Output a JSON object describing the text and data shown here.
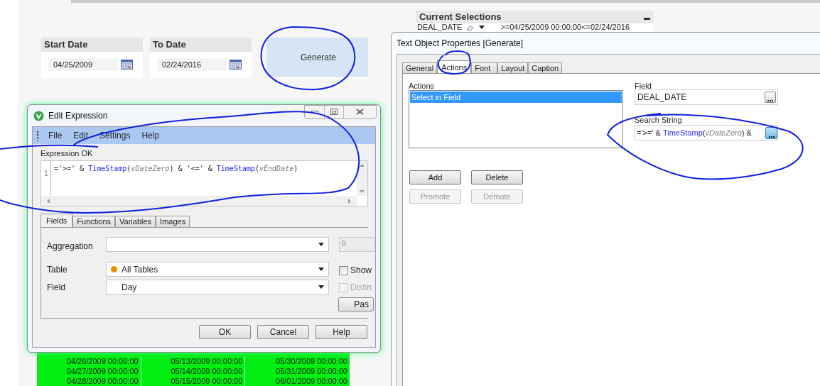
{
  "filters": [
    {
      "title": "Start Date",
      "value": "04/25/2009"
    },
    {
      "title": "To Date",
      "value": "02/24/2016"
    }
  ],
  "generate_button": {
    "label": "Generate"
  },
  "current_selections": {
    "title": "Current Selections",
    "field": "DEAL_DATE",
    "value": ">=04/25/2009 00:00:00<=02/24/2016"
  },
  "table": {
    "rows": [
      [
        "04/26/2009 00:00:00",
        "05/13/2009 00:00:00",
        "05/30/2009 00:00:00"
      ],
      [
        "04/27/2009 00:00:00",
        "05/14/2009 00:00:00",
        "05/31/2009 00:00:00"
      ],
      [
        "04/28/2009 00:00:00",
        "05/15/2009 00:00:00",
        "06/01/2009 00:00:00"
      ]
    ]
  },
  "expression_dialog": {
    "title": "Edit Expression",
    "menu": [
      "File",
      "Edit",
      "Settings",
      "Help"
    ],
    "status": "Expression OK",
    "line_number": "1",
    "tokens": [
      {
        "kind": "plain",
        "text": "='>=' & "
      },
      {
        "kind": "function",
        "text": "TimeStamp"
      },
      {
        "kind": "plain",
        "text": "("
      },
      {
        "kind": "variable",
        "text": "vDateZero"
      },
      {
        "kind": "plain",
        "text": ") & '<=' & "
      },
      {
        "kind": "function",
        "text": "TimeStamp"
      },
      {
        "kind": "plain",
        "text": "("
      },
      {
        "kind": "variable",
        "text": "vEndDate"
      },
      {
        "kind": "plain",
        "text": ")"
      }
    ],
    "tabs": [
      {
        "label": "Fields",
        "selected": true
      },
      {
        "label": "Functions",
        "selected": false
      },
      {
        "label": "Variables",
        "selected": false
      },
      {
        "label": "Images",
        "selected": false
      }
    ],
    "aggregation_label": "Aggregation",
    "side_value": "0",
    "table_label": "Table",
    "table_value": "All Tables",
    "show_label": "Show",
    "show_checked": false,
    "field_label": "Field",
    "field_value": "Day",
    "distinct_label": "Distin",
    "distinct_disabled": true,
    "paste_label": "Pas",
    "buttons": [
      "OK",
      "Cancel",
      "Help"
    ]
  },
  "properties_dialog": {
    "title": "Text Object Properties [Generate]",
    "tabs": [
      {
        "label": "General",
        "selected": false
      },
      {
        "label": "Actions",
        "selected": true
      },
      {
        "label": "Font",
        "selected": false
      },
      {
        "label": "Layout",
        "selected": false
      },
      {
        "label": "Caption",
        "selected": false
      }
    ],
    "actions_label": "Actions",
    "actions": [
      {
        "label": "Select in Field",
        "selected": true
      }
    ],
    "field_label": "Field",
    "field_value": "DEAL_DATE",
    "search_label": "Search String",
    "search_tokens": [
      {
        "kind": "plain",
        "text": "='>=' & "
      },
      {
        "kind": "function",
        "text": "TimeStamp"
      },
      {
        "kind": "plain",
        "text": "("
      },
      {
        "kind": "variable",
        "text": "vDateZero"
      },
      {
        "kind": "plain",
        "text": ") &"
      }
    ],
    "buttons": [
      {
        "label": "Add",
        "disabled": false
      },
      {
        "label": "Delete",
        "disabled": false
      },
      {
        "label": "Promote",
        "disabled": true
      },
      {
        "label": "Demote",
        "disabled": true
      }
    ]
  }
}
